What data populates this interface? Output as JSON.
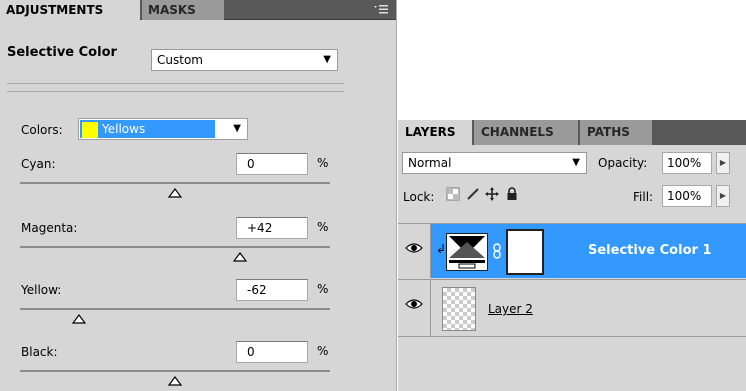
{
  "adjustments": {
    "tabs": [
      "ADJUSTMENTS",
      "MASKS"
    ],
    "title": "Selective Color",
    "preset": "Custom",
    "colors_label": "Colors:",
    "colors_value": "Yellows",
    "colors_swatch": "#ffff00",
    "percent_sign": "%",
    "sliders": [
      {
        "label": "Cyan:",
        "value": "0",
        "level": 0
      },
      {
        "label": "Magenta:",
        "value": "+42",
        "level": 42
      },
      {
        "label": "Yellow:",
        "value": "-62",
        "level": -62
      },
      {
        "label": "Black:",
        "value": "0",
        "level": 0
      }
    ],
    "slider_range": [
      -100,
      100
    ]
  },
  "layers": {
    "tabs": [
      "LAYERS",
      "CHANNELS",
      "PATHS"
    ],
    "blend_mode": "Normal",
    "opacity_label": "Opacity:",
    "opacity_value": "100%",
    "lock_label": "Lock:",
    "fill_label": "Fill:",
    "fill_value": "100%",
    "rows": [
      {
        "name": "Selective Color 1",
        "selected": true
      },
      {
        "name": "Layer 2",
        "selected": false
      }
    ]
  },
  "colors": {
    "selection": "#3399ff",
    "panel": "#d6d6d6",
    "tabbar": "#595959"
  }
}
